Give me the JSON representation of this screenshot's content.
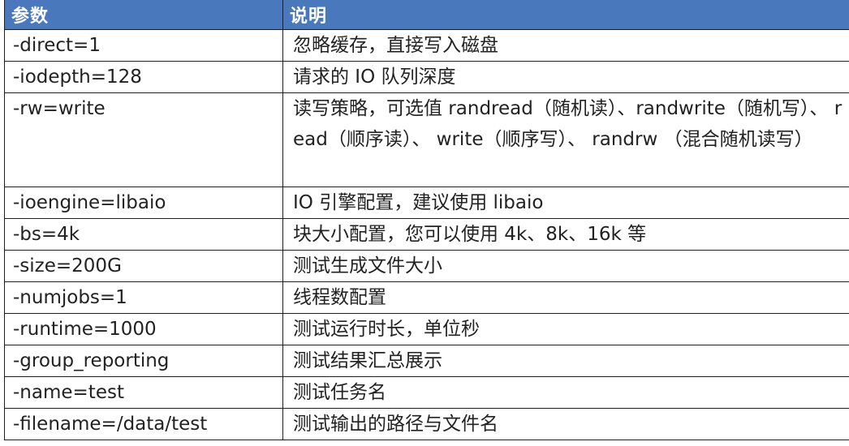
{
  "table": {
    "headers": [
      "参数",
      "说明"
    ],
    "rows": [
      {
        "param": "-direct=1",
        "desc": "忽略缓存，直接写入磁盘"
      },
      {
        "param": "-iodepth=128",
        "desc": "请求的 IO 队列深度"
      },
      {
        "param": "-rw=write",
        "desc": "读写策略，可选值 randread（随机读）、randwrite（随机写）、 read（顺序读）、 write（顺序写）、 randrw （混合随机读写）"
      },
      {
        "param": "-ioengine=libaio",
        "desc": "IO 引擎配置，建议使用 libaio"
      },
      {
        "param": "-bs=4k",
        "desc": "块大小配置，您可以使用 4k、8k、16k 等"
      },
      {
        "param": "-size=200G",
        "desc": "测试生成文件大小"
      },
      {
        "param": "-numjobs=1",
        "desc": "线程数配置"
      },
      {
        "param": "-runtime=1000",
        "desc": "测试运行时长，单位秒"
      },
      {
        "param": "-group_reporting",
        "desc": "测试结果汇总展示"
      },
      {
        "param": "-name=test",
        "desc": "测试任务名"
      },
      {
        "param": "-filename=/data/test",
        "desc": "测试输出的路径与文件名"
      }
    ]
  }
}
